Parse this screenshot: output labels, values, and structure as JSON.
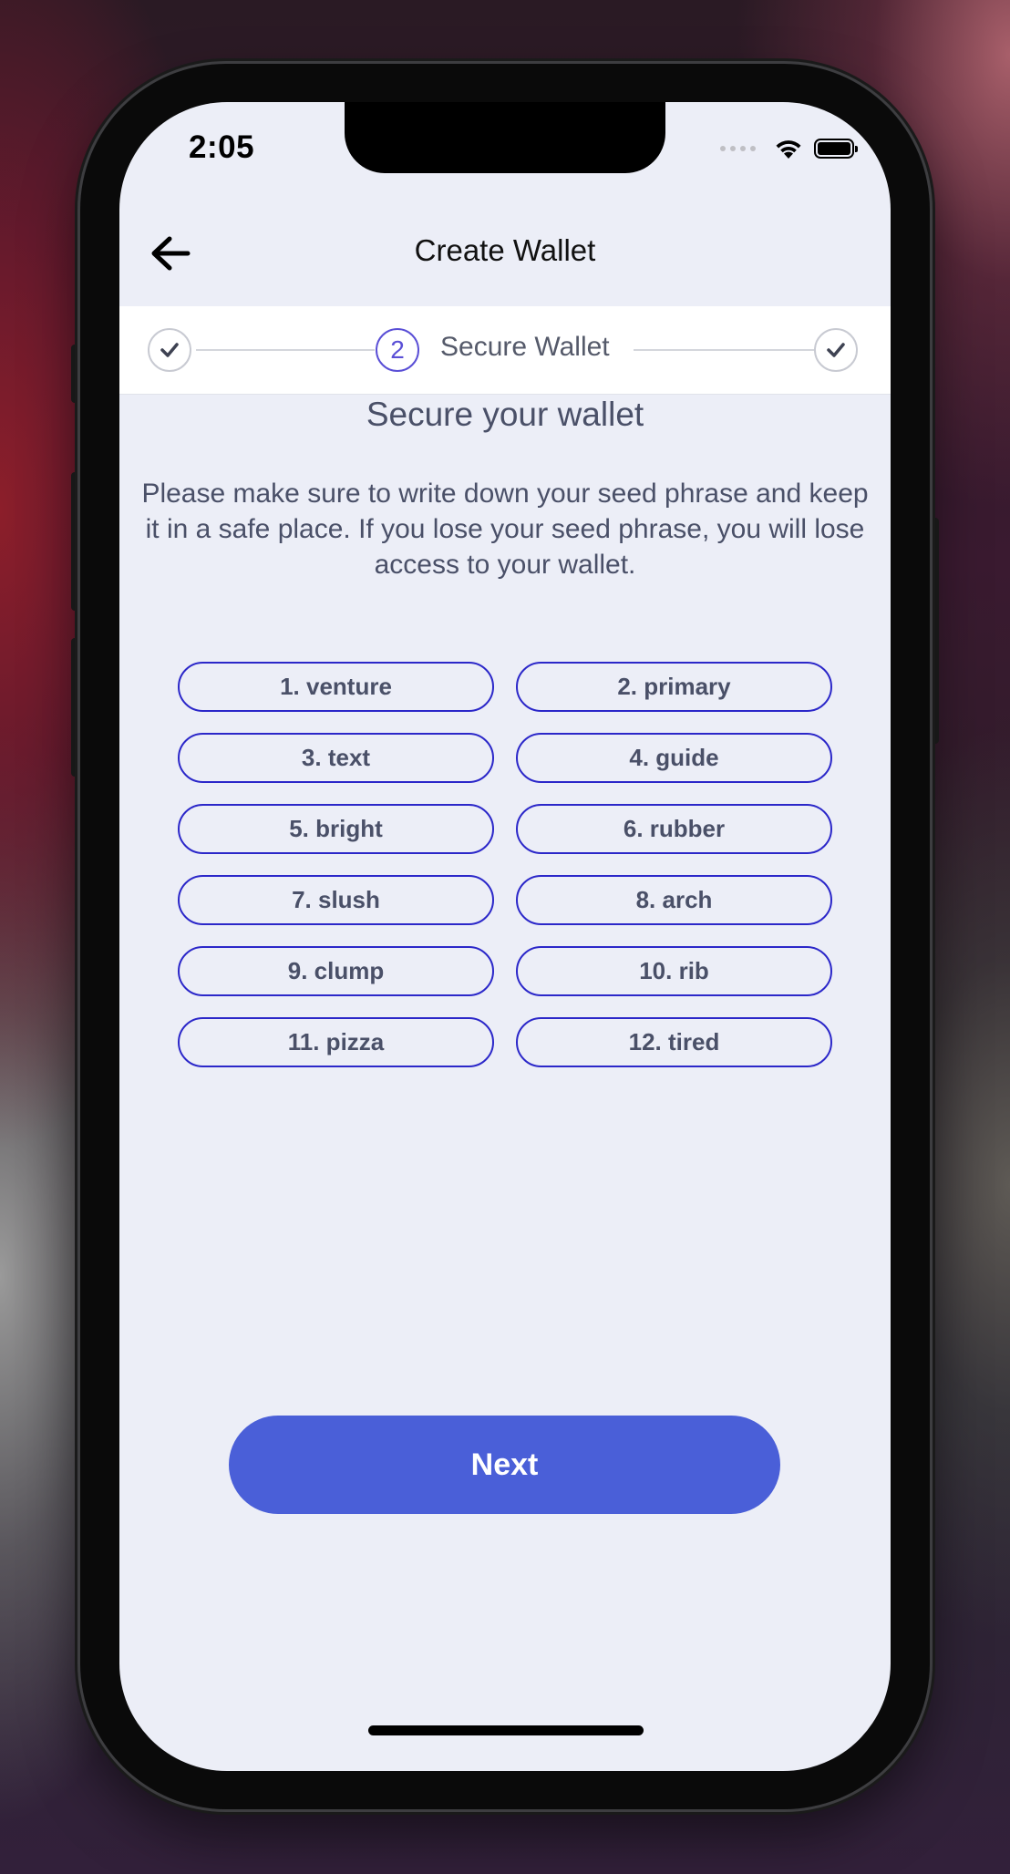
{
  "status_bar": {
    "time": "2:05"
  },
  "header": {
    "title": "Create Wallet",
    "back_icon": "arrow-left-icon"
  },
  "stepper": {
    "steps": [
      {
        "state": "completed",
        "icon": "check-icon"
      },
      {
        "state": "active",
        "number": "2",
        "label": "Secure Wallet"
      },
      {
        "state": "completed",
        "icon": "check-icon"
      }
    ],
    "active_color": "#5a4fd6"
  },
  "main": {
    "heading": "Secure your wallet",
    "description": "Please make sure to write down your seed phrase and keep it in a safe place. If you lose your seed phrase, you will lose access to your wallet.",
    "seed_words": [
      "1. venture",
      "2. primary",
      "3. text",
      "4. guide",
      "5. bright",
      "6. rubber",
      "7. slush",
      "8. arch",
      "9. clump",
      "10. rib",
      "11. pizza",
      "12. tired"
    ],
    "pill_border_color": "#2b27c9"
  },
  "footer": {
    "next_label": "Next",
    "button_color": "#4a5fd8"
  }
}
